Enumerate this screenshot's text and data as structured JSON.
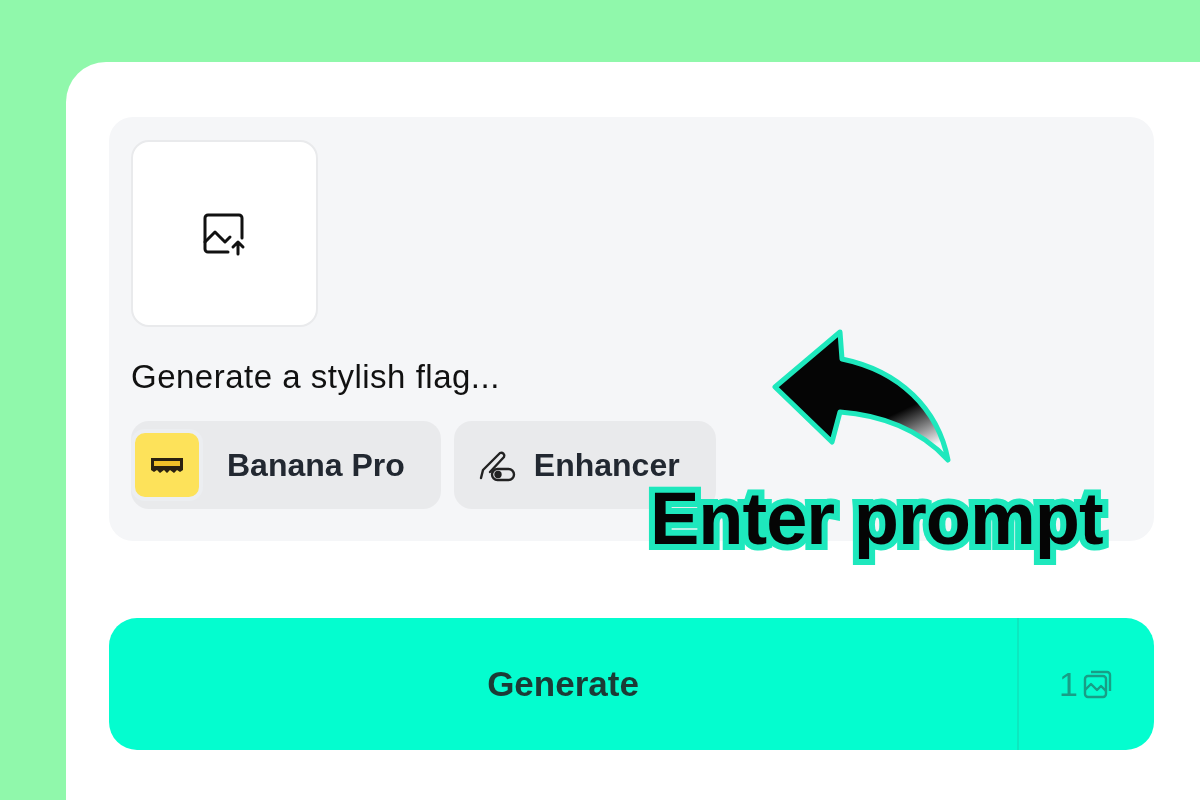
{
  "prompt": {
    "value": "Generate a stylish flag..."
  },
  "chips": [
    {
      "label": "Banana Pro",
      "kind": "model"
    },
    {
      "label": "Enhancer",
      "kind": "enhancer"
    }
  ],
  "generate_button": {
    "label": "Generate",
    "count": "1"
  },
  "annotation": {
    "label": "Enter prompt"
  }
}
